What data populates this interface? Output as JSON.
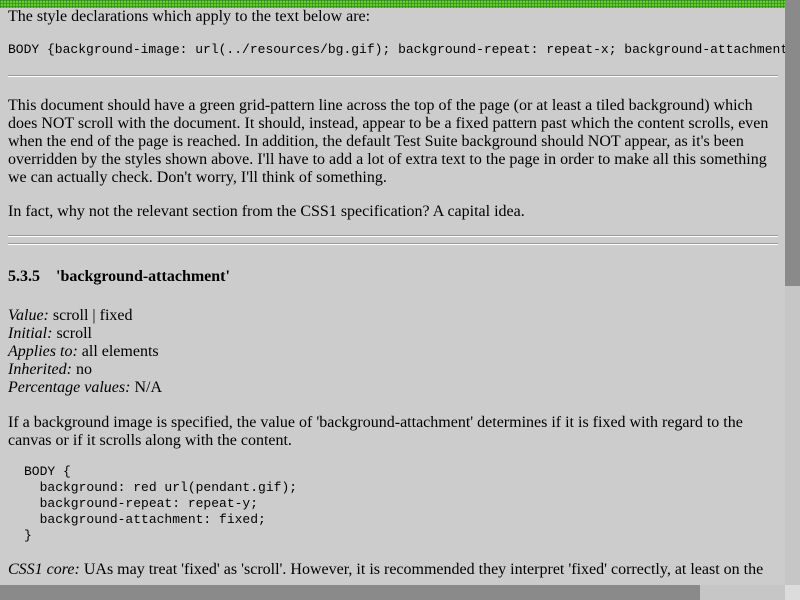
{
  "intro_text": "The style declarations which apply to the text below are:",
  "style_code": "BODY {background-image: url(../resources/bg.gif); background-repeat: repeat-x; background-attachment: fixed;}",
  "description": "This document should have a green grid-pattern line across the top of the page (or at least a tiled background) which does NOT scroll with the document. It should, instead, appear to be a fixed pattern past which the content scrolls, even when the end of the page is reached. In addition, the default Test Suite background should NOT appear, as it's been overridden by the styles shown above. I'll have to add a lot of extra text to the page in order to make all this something we can actually check. Don't worry, I'll think of something.",
  "followup": "In fact, why not the relevant section from the CSS1 specification? A capital idea.",
  "section": {
    "number": "5.3.5",
    "title": "'background-attachment'"
  },
  "properties": [
    {
      "label": "Value:",
      "value": "scroll | fixed"
    },
    {
      "label": "Initial:",
      "value": "scroll"
    },
    {
      "label": "Applies to:",
      "value": "all elements"
    },
    {
      "label": "Inherited:",
      "value": "no"
    },
    {
      "label": "Percentage values:",
      "value": "N/A"
    }
  ],
  "explanation": "If a background image is specified, the value of 'background-attachment' determines if it is fixed with regard to the canvas or if it scrolls along with the content.",
  "example_code": "BODY {\n  background: red url(pendant.gif);\n  background-repeat: repeat-y;\n  background-attachment: fixed;\n}",
  "core_note": {
    "label": "CSS1 core:",
    "text": "UAs may treat 'fixed' as 'scroll'. However, it is recommended they interpret 'fixed' correctly, at least on the"
  },
  "colors": {
    "background": "#cccccc",
    "grid_strip": "#66cc33",
    "scrollbar_thumb": "#8a8a8a"
  }
}
